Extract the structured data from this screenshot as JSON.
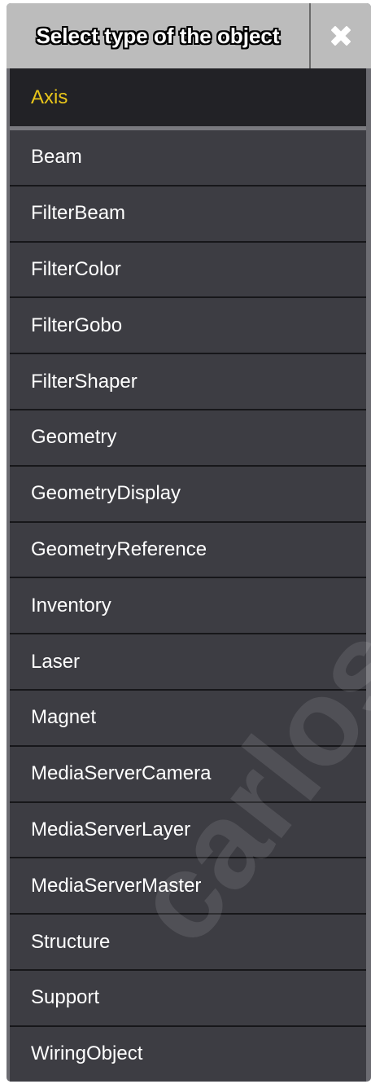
{
  "dialog": {
    "title": "Select type of the object",
    "close_icon": "close-x-icon",
    "items": [
      {
        "label": "Axis",
        "selected": true
      },
      {
        "label": "Beam"
      },
      {
        "label": "FilterBeam"
      },
      {
        "label": "FilterColor"
      },
      {
        "label": "FilterGobo"
      },
      {
        "label": "FilterShaper"
      },
      {
        "label": "Geometry"
      },
      {
        "label": "GeometryDisplay"
      },
      {
        "label": "GeometryReference"
      },
      {
        "label": "Inventory"
      },
      {
        "label": "Laser"
      },
      {
        "label": "Magnet"
      },
      {
        "label": "MediaServerCamera"
      },
      {
        "label": "MediaServerLayer"
      },
      {
        "label": "MediaServerMaster"
      },
      {
        "label": "Structure"
      },
      {
        "label": "Support"
      },
      {
        "label": "WiringObject"
      }
    ]
  },
  "watermark": "carlos",
  "colors": {
    "title_bar": "#bcbcbc",
    "item_bg": "#3d3d43",
    "selected_bg": "#222226",
    "selected_text": "#e8c51a",
    "text": "#ffffff"
  }
}
